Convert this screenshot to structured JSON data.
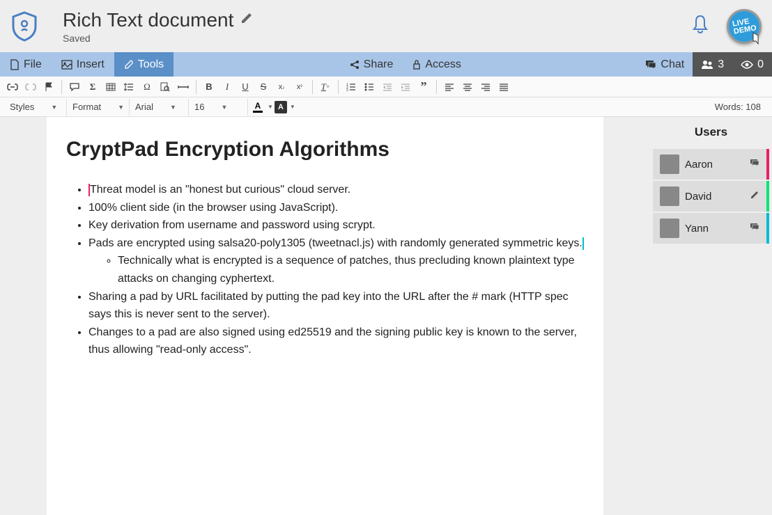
{
  "header": {
    "title": "Rich Text document",
    "status": "Saved"
  },
  "menu": {
    "file": "File",
    "insert": "Insert",
    "tools": "Tools",
    "share": "Share",
    "access": "Access",
    "chat": "Chat",
    "users_count": "3",
    "viewers_count": "0"
  },
  "toolbar": {
    "styles": "Styles",
    "format": "Format",
    "font": "Arial",
    "size": "16",
    "word_count": "Words: 108"
  },
  "users_panel": {
    "title": "Users",
    "users": [
      {
        "name": "Aaron",
        "color": "#e91e63",
        "mode": "comment"
      },
      {
        "name": "David",
        "color": "#00e676",
        "mode": "edit"
      },
      {
        "name": "Yann",
        "color": "#00bcd4",
        "mode": "comment"
      }
    ]
  },
  "document": {
    "title": "CryptPad Encryption Algorithms",
    "bullets": [
      "Threat model is an \"honest but curious\" cloud server.",
      "100% client side (in the browser using JavaScript).",
      "Key derivation from username and password using scrypt.",
      "Pads are encrypted using salsa20-poly1305 (tweetnacl.js) with randomly generated symmetric keys.",
      "Sharing a pad by URL facilitated by putting the pad key into the URL after the # mark (HTTP spec says this is never sent to the server).",
      "Changes to a pad are also signed using ed25519 and the signing public key is known to the server, thus allowing \"read-only access\"."
    ],
    "sub_bullet": "Technically what is encrypted is a sequence of patches, thus precluding known plaintext type attacks on changing cyphertext."
  },
  "cursors": {
    "c1_color": "#e91e63",
    "c2_color": "#00bcd4"
  }
}
